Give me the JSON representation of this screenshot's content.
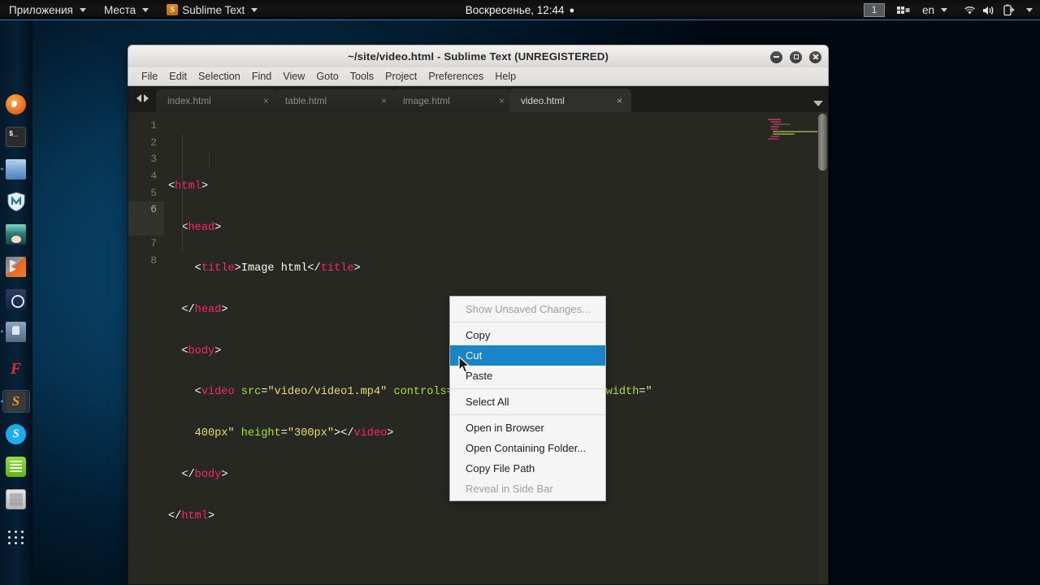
{
  "top_panel": {
    "applications_label": "Приложения",
    "places_label": "Места",
    "app_label": "Sublime Text",
    "app_badge": "S",
    "clock": "Воскресенье, 12:44",
    "clock_dot": "●",
    "workspace": "1",
    "keyboard_layout": "en",
    "icons": {
      "applications_caret": "chevron-down-icon",
      "places_caret": "chevron-down-icon",
      "app_caret": "chevron-down-icon",
      "workspace_switcher": "workspace-switcher-icon",
      "layout_caret": "chevron-down-icon",
      "wifi": "wifi-icon",
      "volume": "volume-icon",
      "battery": "battery-icon",
      "system_caret": "chevron-down-icon"
    }
  },
  "dock": {
    "items": [
      {
        "name": "firefox",
        "label": "Firefox",
        "running": false,
        "active": false
      },
      {
        "name": "terminal",
        "label": "Terminal",
        "prompt": "$_",
        "running": false,
        "active": false
      },
      {
        "name": "files",
        "label": "Files",
        "running": true,
        "active": false
      },
      {
        "name": "malware-shield",
        "label": "Shield",
        "running": false,
        "active": false
      },
      {
        "name": "anime-player",
        "label": "Player",
        "running": false,
        "active": false
      },
      {
        "name": "gimp",
        "label": "GIMP",
        "running": false,
        "active": false
      },
      {
        "name": "inkscape",
        "label": "Inkscape",
        "running": false,
        "active": false
      },
      {
        "name": "gps-tool",
        "label": "GPS",
        "running": true,
        "active": false
      },
      {
        "name": "fl-studio",
        "label": "FL Studio",
        "running": false,
        "active": false
      },
      {
        "name": "sublime-text",
        "label": "Sublime Text",
        "badge": "S",
        "running": true,
        "active": true
      },
      {
        "name": "skype",
        "label": "Skype",
        "badge": "S",
        "running": false,
        "active": false
      },
      {
        "name": "notes",
        "label": "Notes",
        "running": false,
        "active": false
      },
      {
        "name": "calculator",
        "label": "Calculator",
        "running": false,
        "active": false
      },
      {
        "name": "show-applications",
        "label": "Show Applications",
        "running": false,
        "active": false
      }
    ]
  },
  "window": {
    "title": "~/site/video.html - Sublime Text (UNREGISTERED)",
    "buttons": {
      "minimize": "minimize-icon",
      "maximize": "maximize-icon",
      "close": "close-icon"
    },
    "menu": [
      "File",
      "Edit",
      "Selection",
      "Find",
      "View",
      "Goto",
      "Tools",
      "Project",
      "Preferences",
      "Help"
    ],
    "tabs": [
      {
        "label": "index.html",
        "close": "×",
        "active": false
      },
      {
        "label": "table.html",
        "close": "×",
        "active": false
      },
      {
        "label": "image.html",
        "close": "×",
        "active": false
      },
      {
        "label": "video.html",
        "close": "×",
        "active": true
      }
    ]
  },
  "editor": {
    "line_numbers": [
      "1",
      "2",
      "3",
      "4",
      "5",
      "6",
      "",
      "7",
      "8"
    ],
    "current_line": "6",
    "lines": [
      {
        "n": "1",
        "text": "<html>"
      },
      {
        "n": "2",
        "text": "  <head>"
      },
      {
        "n": "3",
        "text": "    <title>Image html</title>"
      },
      {
        "n": "4",
        "text": "  </head>"
      },
      {
        "n": "5",
        "text": "  <body>"
      },
      {
        "n": "6",
        "text": "    <video src=\"video/video1.mp4\" controls=\"controls\" loop=\"loop\" width=\"400px\" height=\"300px\"></video>"
      },
      {
        "n": "7",
        "text": "  </body>"
      },
      {
        "n": "8",
        "text": "</html>"
      }
    ],
    "colors": {
      "background": "#272822",
      "tag": "#f92672",
      "attribute": "#a6e22e",
      "string": "#e6db74",
      "text": "#f8f8f2",
      "gutter": "#7c7d72",
      "current_line_gutter": "#32332c"
    }
  },
  "context_menu": {
    "items": [
      {
        "label": "Show Unsaved Changes...",
        "state": "disabled"
      },
      {
        "separator": true
      },
      {
        "label": "Copy",
        "state": "normal"
      },
      {
        "label": "Cut",
        "state": "selected"
      },
      {
        "label": "Paste",
        "state": "normal"
      },
      {
        "separator": true
      },
      {
        "label": "Select All",
        "state": "normal"
      },
      {
        "separator": true
      },
      {
        "label": "Open in Browser",
        "state": "normal"
      },
      {
        "label": "Open Containing Folder...",
        "state": "normal"
      },
      {
        "label": "Copy File Path",
        "state": "normal"
      },
      {
        "label": "Reveal in Side Bar",
        "state": "disabled"
      }
    ],
    "highlight_color": "#1a84c8"
  }
}
